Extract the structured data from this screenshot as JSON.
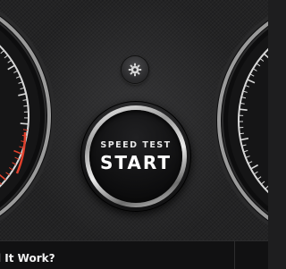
{
  "start_button": {
    "line1": "SPEED TEST",
    "line2": "START"
  },
  "bottom_bar": {
    "link_text": "l It Work?"
  },
  "icons": {
    "settings": "gear-icon"
  },
  "colors": {
    "accent_red": "#e0402c",
    "background": "#232324",
    "button_face": "#0e0e0f",
    "chrome_ring": "#d0d0d0"
  }
}
